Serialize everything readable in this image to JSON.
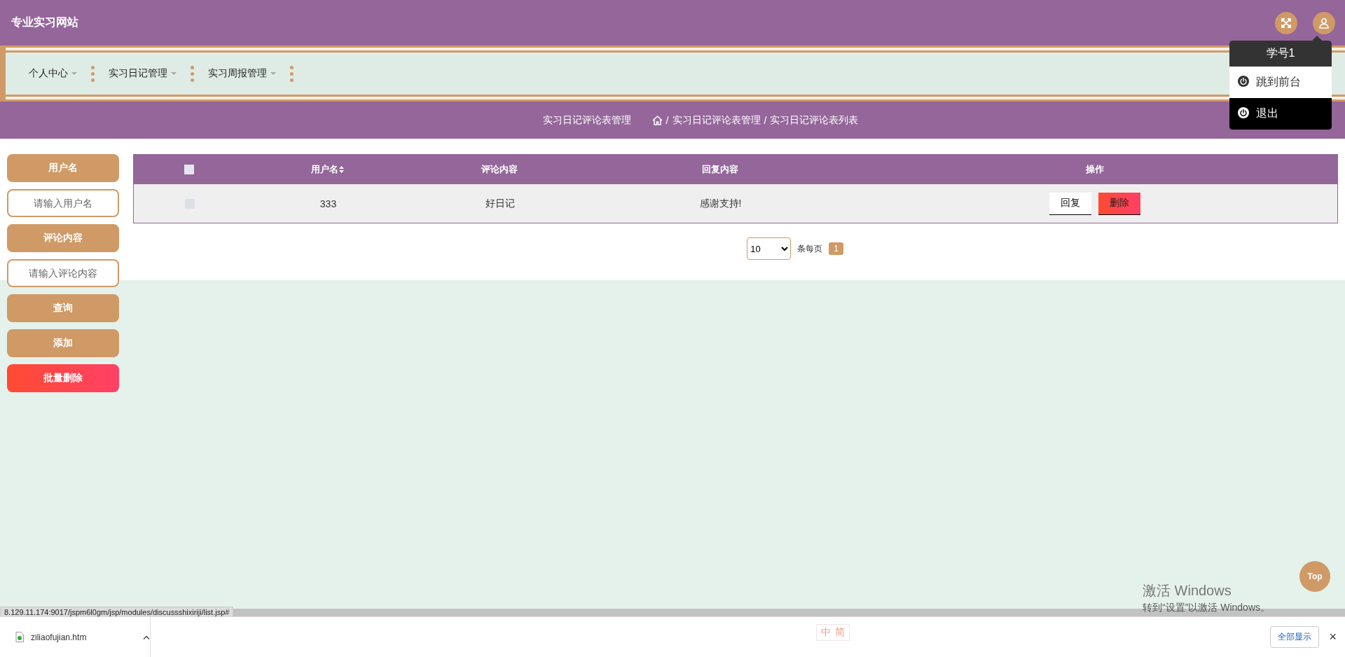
{
  "header": {
    "title": "专业实习网站"
  },
  "nav": {
    "items": [
      {
        "label": "个人中心"
      },
      {
        "label": "实习日记管理"
      },
      {
        "label": "实习周报管理"
      }
    ]
  },
  "breadcrumb": {
    "title": "实习日记评论表管理",
    "separator": "/",
    "path": [
      "实习日记评论表管理",
      "实习日记评论表列表"
    ]
  },
  "user_menu": {
    "expanded": true,
    "account": "学号1",
    "items": [
      {
        "label": "跳到前台",
        "selected": false
      },
      {
        "label": "退出",
        "selected": true
      }
    ]
  },
  "search": {
    "fields": [
      {
        "label": "用户名",
        "placeholder": "请输入用户名"
      },
      {
        "label": "评论内容",
        "placeholder": "请输入评论内容"
      }
    ],
    "buttons": [
      {
        "label": "查询",
        "kind": "primary"
      },
      {
        "label": "添加",
        "kind": "primary"
      },
      {
        "label": "批量删除",
        "kind": "danger"
      }
    ]
  },
  "table": {
    "select_all": {
      "checked": false
    },
    "columns": [
      {
        "label": "用户名",
        "sortable": true
      },
      {
        "label": "评论内容",
        "sortable": false
      },
      {
        "label": "回复内容",
        "sortable": false
      },
      {
        "label": "操作",
        "sortable": false
      }
    ],
    "rows": [
      {
        "checked": false,
        "cells": [
          "333",
          "好日记",
          "感谢支持!"
        ],
        "actions": [
          {
            "label": "回复",
            "kind": "default"
          },
          {
            "label": "删除",
            "kind": "danger"
          }
        ]
      }
    ]
  },
  "pagination": {
    "page_size": "10",
    "page_size_label": "条每页",
    "pages": [
      {
        "label": "1",
        "selected": true
      }
    ]
  },
  "top_button": "Top",
  "status_url": "8.129.11.174:9017/jspm6l0gm/jsp/modules/discussshixiriji/list.jsp#",
  "windows_activation": {
    "title": "激活 Windows",
    "hint": "转到“设置”以激活 Windows。"
  },
  "ime_toolbar": {
    "items": [
      "中",
      "简"
    ]
  },
  "downloads": {
    "items": [
      {
        "name": "ziliaofujian.htm"
      }
    ],
    "show_all": "全部显示",
    "close": "×"
  }
}
